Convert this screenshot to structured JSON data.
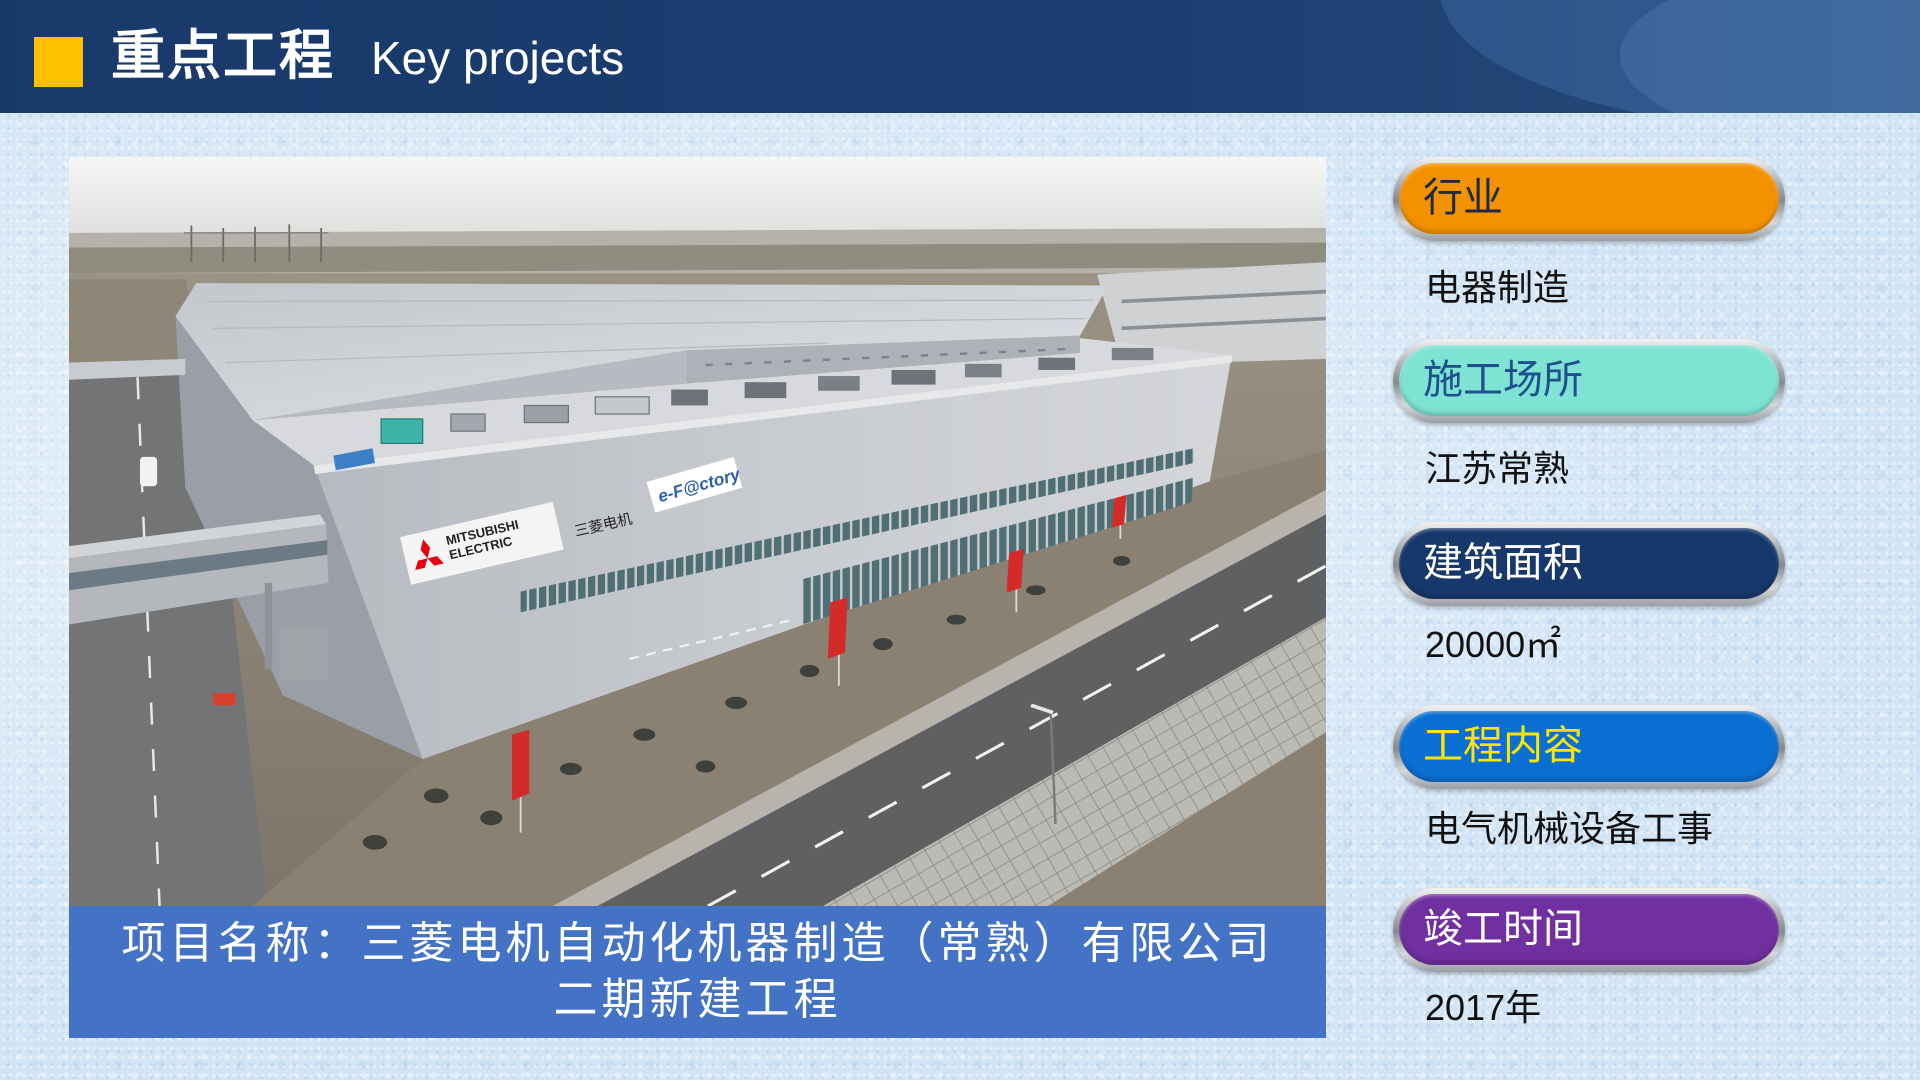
{
  "header": {
    "title_cn": "重点工程",
    "title_en": "Key projects"
  },
  "photo": {
    "signage": {
      "brand_line1": "MITSUBISHI",
      "brand_line2": "ELECTRIC",
      "brand_cn": "三菱电机",
      "product": "e-F@ctory"
    }
  },
  "caption": {
    "line1": "项目名称：三菱电机自动化机器制造（常熟）有限公司",
    "line2": "二期新建工程"
  },
  "details": [
    {
      "label": "行业",
      "value": "电器制造",
      "pill_color": "#f39200",
      "text_color": "#1e2a44"
    },
    {
      "label": "施工场所",
      "value": "江苏常熟",
      "pill_color": "#7fe3d3",
      "text_color": "#1f4f8c"
    },
    {
      "label": "建筑面积",
      "value": "20000㎡",
      "pill_color": "#17386b",
      "text_color": "#ffffff"
    },
    {
      "label": "工程内容",
      "value": "电气机械设备工事",
      "pill_color": "#0a6fd2",
      "text_color": "#ffe600"
    },
    {
      "label": "竣工时间",
      "value": "2017年",
      "pill_color": "#7030a0",
      "text_color": "#ffffff"
    }
  ],
  "colors": {
    "page_bg": "#d3e5f5",
    "header_bg": "#1a3d70",
    "title_marker": "#ffc000",
    "caption_bg": "#4472c4"
  }
}
